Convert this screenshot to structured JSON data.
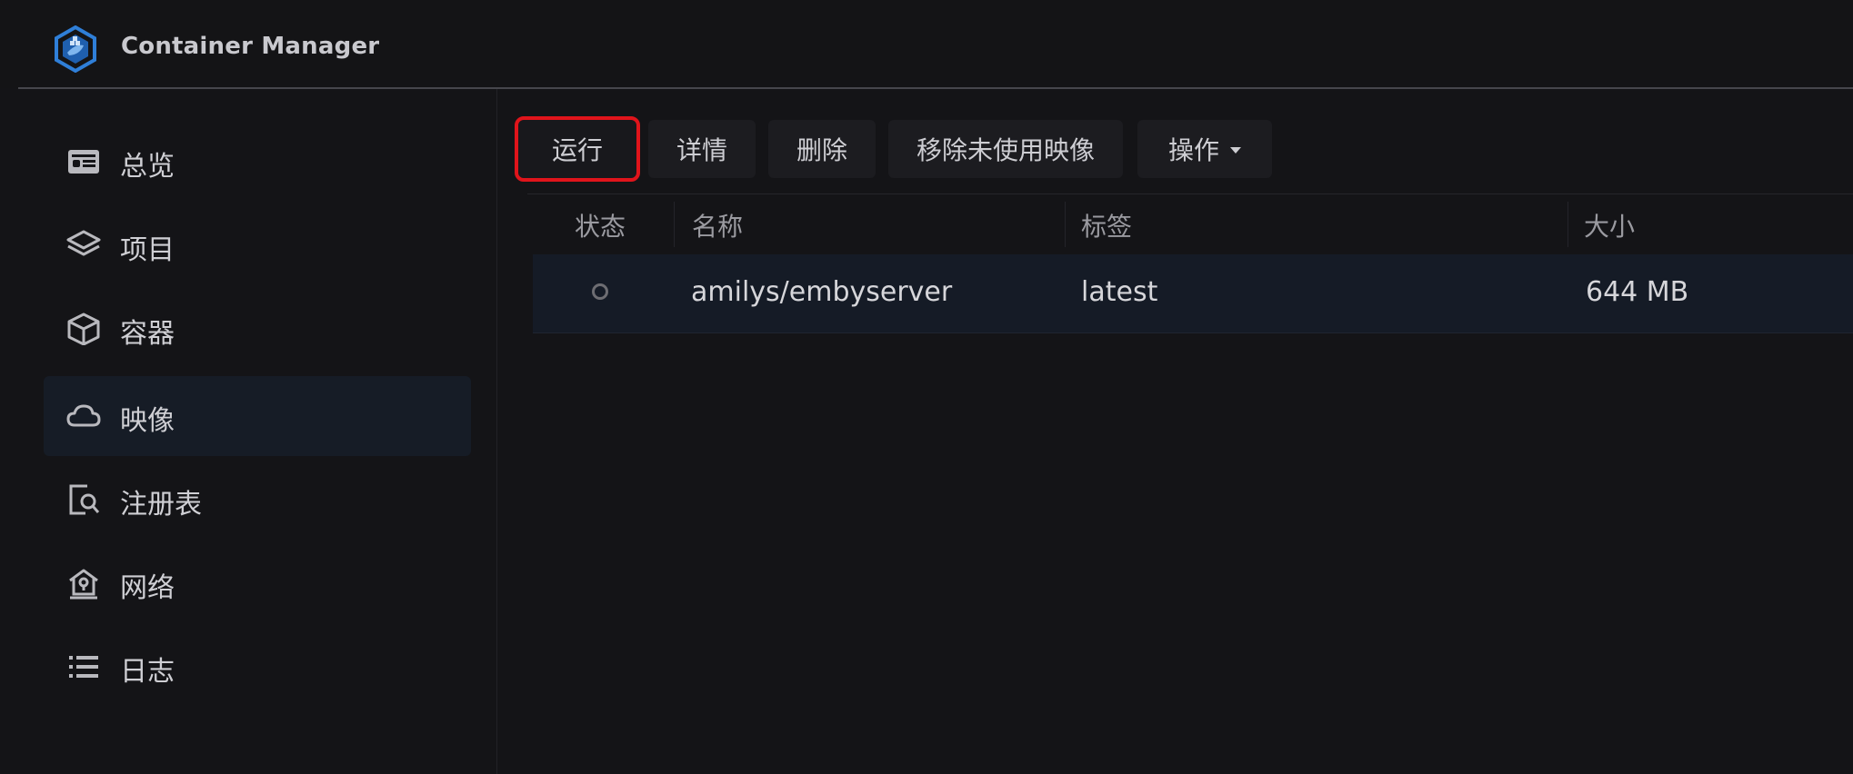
{
  "app": {
    "title": "Container Manager"
  },
  "sidebar": {
    "items": [
      {
        "label": "总览",
        "icon": "overview-card-icon"
      },
      {
        "label": "项目",
        "icon": "layers-icon"
      },
      {
        "label": "容器",
        "icon": "cube-icon"
      },
      {
        "label": "映像",
        "icon": "cloud-icon",
        "active": true
      },
      {
        "label": "注册表",
        "icon": "registry-search-icon"
      },
      {
        "label": "网络",
        "icon": "network-home-icon"
      },
      {
        "label": "日志",
        "icon": "list-icon"
      }
    ]
  },
  "toolbar": {
    "run_label": "运行",
    "details_label": "详情",
    "delete_label": "删除",
    "remove_unused_label": "移除未使用映像",
    "actions_label": "操作"
  },
  "table": {
    "columns": [
      "状态",
      "名称",
      "标签",
      "大小"
    ],
    "rows": [
      {
        "status": "stopped",
        "name": "amilys/embyserver",
        "tag": "latest",
        "size": "644 MB"
      }
    ]
  },
  "colors": {
    "background": "#141417",
    "active_nav": "#161c26",
    "selected_row": "#151b26",
    "highlight_outline": "#e0141b",
    "logo_blue": "#2f7fd8"
  }
}
